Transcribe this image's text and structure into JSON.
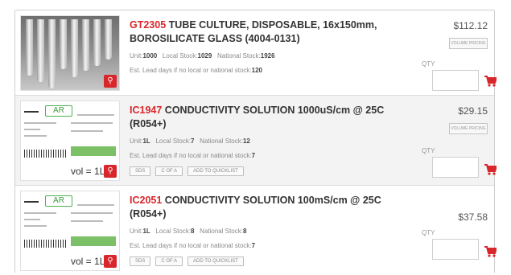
{
  "products": [
    {
      "sku": "GT2305",
      "title": "TUBE CULTURE, DISPOSABLE, 16x150mm, BOROSILICATE GLASS (4004-0131)",
      "unit_label": "Unit:",
      "unit": "1000",
      "local_label": "Local Stock:",
      "local": "1029",
      "national_label": "National Stock:",
      "national": "1926",
      "lead_label": "Est. Lead days if no local or national stock:",
      "lead": "120",
      "price": "$112.12",
      "volume_pricing": "VOLUME PRICING",
      "qty_label": "QTY",
      "qty_value": "",
      "image_icon": "tubes-photo",
      "buttons": []
    },
    {
      "sku": "IC1947",
      "title": "CONDUCTIVITY SOLUTION 1000uS/cm @ 25C (R054+)",
      "unit_label": "Unit:",
      "unit": "1L",
      "local_label": "Local Stock:",
      "local": "7",
      "national_label": "National Stock:",
      "national": "12",
      "lead_label": "Est. Lead days if no local or national stock:",
      "lead": "7",
      "price": "$29.15",
      "volume_pricing": "VOLUME PRICING",
      "qty_label": "QTY",
      "qty_value": "",
      "image_icon": "label-card",
      "image_brand": "AR",
      "image_vol": "vol = 1L",
      "buttons": [
        "SDS",
        "C OF A",
        "ADD TO QUICKLIST"
      ]
    },
    {
      "sku": "IC2051",
      "title": "CONDUCTIVITY SOLUTION 100mS/cm @ 25C (R054+)",
      "unit_label": "Unit:",
      "unit": "1L",
      "local_label": "Local Stock:",
      "local": "8",
      "national_label": "National Stock:",
      "national": "8",
      "lead_label": "Est. Lead days if no local or national stock:",
      "lead": "7",
      "price": "$37.58",
      "qty_label": "QTY",
      "qty_value": "",
      "image_icon": "label-card",
      "image_brand": "AR",
      "image_vol": "vol = 1L",
      "buttons": [
        "SDS",
        "C OF A",
        "ADD TO QUICKLIST"
      ]
    }
  ],
  "zoom_glyph": "⚲",
  "colors": {
    "accent": "#d9262b",
    "title": "#333333",
    "muted": "#8a8a8a"
  }
}
